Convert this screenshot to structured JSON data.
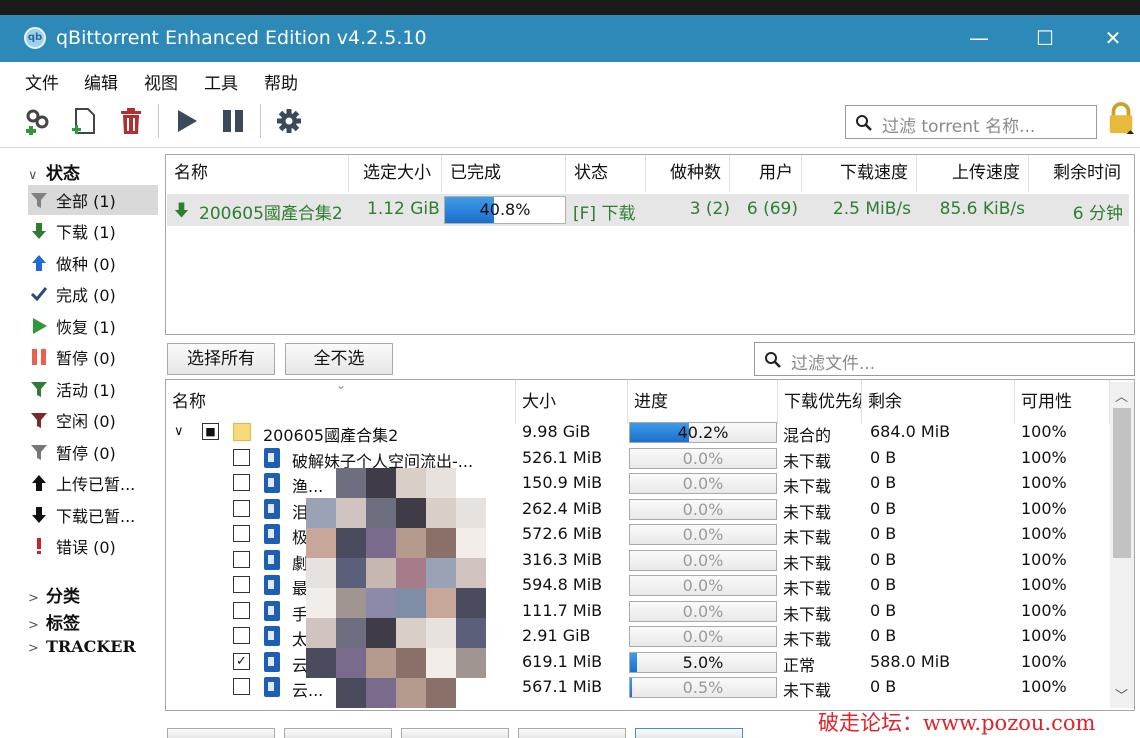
{
  "window": {
    "title": "qBittorrent Enhanced Edition v4.2.5.10",
    "app_icon": "qb",
    "minimize": "—",
    "maximize": "☐",
    "close": "✕"
  },
  "menu": [
    "文件",
    "编辑",
    "视图",
    "工具",
    "帮助"
  ],
  "toolbar": {
    "search_placeholder": "过滤 torrent 名称..."
  },
  "sidebar": {
    "status_header": "状态",
    "items": [
      {
        "label": "全部 (1)",
        "icon": "filter-icon",
        "selected": true
      },
      {
        "label": "下载 (1)",
        "icon": "download-arrow-icon"
      },
      {
        "label": "做种 (0)",
        "icon": "upload-arrow-icon"
      },
      {
        "label": "完成 (0)",
        "icon": "checkmark-icon"
      },
      {
        "label": "恢复 (1)",
        "icon": "play-icon"
      },
      {
        "label": "暂停 (0)",
        "icon": "pause-icon"
      },
      {
        "label": "活动 (1)",
        "icon": "filter-icon"
      },
      {
        "label": "空闲 (0)",
        "icon": "filter-icon"
      },
      {
        "label": "暂停 (0)",
        "icon": "filter-icon"
      },
      {
        "label": "上传已暂...",
        "icon": "upload-arrow-icon"
      },
      {
        "label": "下载已暂...",
        "icon": "download-arrow-icon"
      },
      {
        "label": "错误 (0)",
        "icon": "error-icon"
      }
    ],
    "categories": "分类",
    "tags": "标签",
    "trackers": "TRACKER"
  },
  "torrents": {
    "headers": [
      "名称",
      "选定大小",
      "已完成",
      "状态",
      "做种数",
      "用户",
      "下载速度",
      "上传速度",
      "剩余时间"
    ],
    "rows": [
      {
        "name": "200605國產合集2",
        "size": "1.12 GiB",
        "progress": 0.408,
        "progress_label": "40.8%",
        "status": "[F] 下载",
        "seeds": "3 (2)",
        "peers": "6 (69)",
        "down_speed": "2.5 MiB/s",
        "up_speed": "85.6 KiB/s",
        "eta": "6 分钟"
      }
    ]
  },
  "files": {
    "select_all": "选择所有",
    "select_none": "全不选",
    "filter_placeholder": "过滤文件...",
    "headers": [
      "名称",
      "大小",
      "进度",
      "下载优先级",
      "剩余",
      "可用性"
    ],
    "folder": {
      "name": "200605國產合集2",
      "size": "9.98 GiB",
      "progress": 0.402,
      "progress_label": "40.2%",
      "priority": "混合的",
      "remaining": "684.0 MiB",
      "availability": "100%"
    },
    "rows": [
      {
        "name": "破解妹子个人空间流出-...",
        "checked": false,
        "size": "526.1 MiB",
        "progress": 0,
        "progress_label": "0.0%",
        "priority": "未下载",
        "remaining": "0 B",
        "availability": "100%"
      },
      {
        "name": "渔...",
        "checked": false,
        "size": "150.9 MiB",
        "progress": 0,
        "progress_label": "0.0%",
        "priority": "未下载",
        "remaining": "0 B",
        "availability": "100%"
      },
      {
        "name": "泪...",
        "checked": false,
        "size": "262.4 MiB",
        "progress": 0,
        "progress_label": "0.0%",
        "priority": "未下载",
        "remaining": "0 B",
        "availability": "100%"
      },
      {
        "name": "极...",
        "checked": false,
        "size": "572.6 MiB",
        "progress": 0,
        "progress_label": "0.0%",
        "priority": "未下载",
        "remaining": "0 B",
        "availability": "100%"
      },
      {
        "name": "劇...",
        "checked": false,
        "size": "316.3 MiB",
        "progress": 0,
        "progress_label": "0.0%",
        "priority": "未下载",
        "remaining": "0 B",
        "availability": "100%"
      },
      {
        "name": "最...",
        "checked": false,
        "size": "594.8 MiB",
        "progress": 0,
        "progress_label": "0.0%",
        "priority": "未下载",
        "remaining": "0 B",
        "availability": "100%"
      },
      {
        "name": "手...",
        "checked": false,
        "size": "111.7 MiB",
        "progress": 0,
        "progress_label": "0.0%",
        "priority": "未下载",
        "remaining": "0 B",
        "availability": "100%"
      },
      {
        "name": "太",
        "checked": false,
        "size": "2.91 GiB",
        "progress": 0,
        "progress_label": "0.0%",
        "priority": "未下载",
        "remaining": "0 B",
        "availability": "100%"
      },
      {
        "name": "云...",
        "checked": true,
        "size": "619.1 MiB",
        "progress": 0.05,
        "progress_label": "5.0%",
        "priority": "正常",
        "remaining": "588.0 MiB",
        "availability": "100%"
      },
      {
        "name": "云...",
        "checked": false,
        "size": "567.1 MiB",
        "progress": 0.005,
        "progress_label": "0.5%",
        "priority": "未下载",
        "remaining": "0 B",
        "availability": "100%"
      }
    ]
  },
  "watermark": "破走论坛：www.pozou.com"
}
